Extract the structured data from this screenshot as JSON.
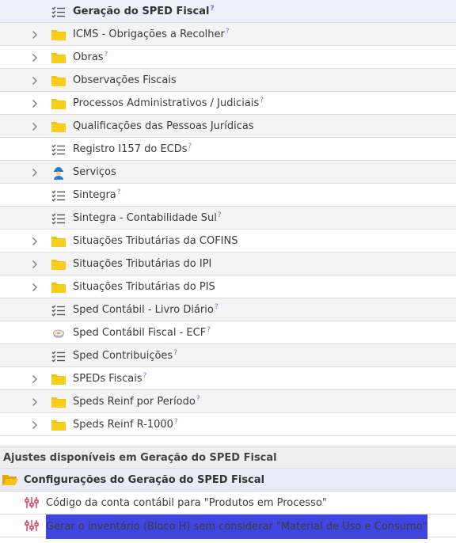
{
  "tree": [
    {
      "label": "Geração do SPED Fiscal",
      "icon": "checklist-icon",
      "expandable": false,
      "help": "?",
      "bold": true,
      "selected": true
    },
    {
      "label": "ICMS - Obrigações a Recolher",
      "icon": "folder-icon",
      "expandable": true,
      "help": "?"
    },
    {
      "label": "Obras",
      "icon": "folder-icon",
      "expandable": true,
      "help": "?"
    },
    {
      "label": "Observações Fiscais",
      "icon": "folder-icon",
      "expandable": true,
      "help": ""
    },
    {
      "label": "Processos Administrativos / Judiciais",
      "icon": "folder-icon",
      "expandable": true,
      "help": "?"
    },
    {
      "label": "Qualificações das Pessoas Jurídicas",
      "icon": "folder-icon",
      "expandable": true,
      "help": ""
    },
    {
      "label": "Registro I157 do ECDs",
      "icon": "checklist-icon",
      "expandable": false,
      "help": "?"
    },
    {
      "label": "Serviços",
      "icon": "worker-icon",
      "expandable": true,
      "help": ""
    },
    {
      "label": "Sintegra",
      "icon": "checklist-icon",
      "expandable": false,
      "help": "?"
    },
    {
      "label": "Sintegra - Contabilidade Sul",
      "icon": "checklist-icon",
      "expandable": false,
      "help": "?"
    },
    {
      "label": "Situações Tributárias da COFINS",
      "icon": "folder-icon",
      "expandable": true,
      "help": ""
    },
    {
      "label": "Situações Tributárias do IPI",
      "icon": "folder-icon",
      "expandable": true,
      "help": ""
    },
    {
      "label": "Situações Tributárias do PIS",
      "icon": "folder-icon",
      "expandable": true,
      "help": ""
    },
    {
      "label": "Sped Contábil - Livro Diário",
      "icon": "checklist-icon",
      "expandable": false,
      "help": "?"
    },
    {
      "label": "Sped Contábil Fiscal - ECF",
      "icon": "disk-icon",
      "expandable": false,
      "help": "?"
    },
    {
      "label": "Sped Contribuições",
      "icon": "checklist-icon",
      "expandable": false,
      "help": "?"
    },
    {
      "label": "SPEDs Fiscais",
      "icon": "folder-icon",
      "expandable": true,
      "help": "?"
    },
    {
      "label": "Speds Reinf por Período",
      "icon": "folder-icon",
      "expandable": true,
      "help": "?"
    },
    {
      "label": "Speds Reinf R-1000",
      "icon": "folder-icon",
      "expandable": true,
      "help": "?"
    }
  ],
  "settings_panel": {
    "header": "Ajustes disponíveis em Geração do SPED Fiscal",
    "group_label": "Configurações do Geração do SPED Fiscal",
    "group_icon": "open-folder-icon",
    "items": [
      {
        "label": "Código da conta contábil para \"Produtos em Processo\"",
        "icon": "sliders-icon",
        "highlighted": false
      },
      {
        "label": "Gerar o inventário (Bloco H) sem considerar \"Material de Uso e Consumo\"",
        "icon": "sliders-icon",
        "highlighted": true
      }
    ]
  },
  "colors": {
    "folder": "#f5c211",
    "highlight": "#4046e0",
    "help": "#7a6cd6"
  }
}
